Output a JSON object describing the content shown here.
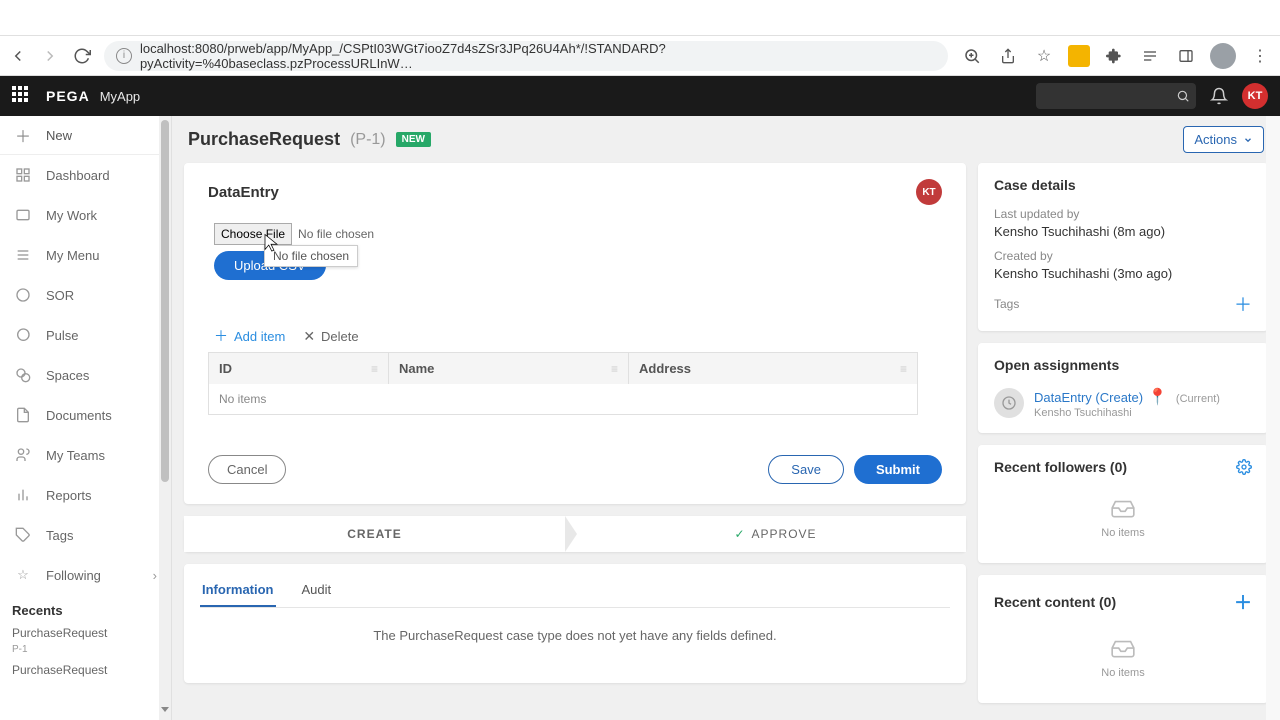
{
  "browser": {
    "url": "localhost:8080/prweb/app/MyApp_/CSPtI03WGt7iooZ7d4sZSr3JPq26U4Ah*/!STANDARD?pyActivity=%40baseclass.pzProcessURLInW…"
  },
  "pegaHeader": {
    "brand": "PEGA",
    "appName": "MyApp",
    "userInitials": "KT"
  },
  "sidebar": {
    "newLabel": "New",
    "items": [
      {
        "label": "Dashboard"
      },
      {
        "label": "My Work"
      },
      {
        "label": "My Menu"
      },
      {
        "label": "SOR"
      },
      {
        "label": "Pulse"
      },
      {
        "label": "Spaces"
      },
      {
        "label": "Documents"
      },
      {
        "label": "My Teams"
      },
      {
        "label": "Reports"
      },
      {
        "label": "Tags"
      },
      {
        "label": "Following"
      }
    ],
    "recentsHeader": "Recents",
    "recents": [
      {
        "label": "PurchaseRequest",
        "sub": "P-1"
      },
      {
        "label": "PurchaseRequest"
      }
    ]
  },
  "caseHeader": {
    "title": "PurchaseRequest",
    "id": "(P-1)",
    "newTag": "NEW",
    "actions": "Actions"
  },
  "dataEntry": {
    "title": "DataEntry",
    "badge": "KT",
    "chooseFile": "Choose File",
    "noFile": "No file chosen",
    "tooltip": "No file chosen",
    "upload": "Upload CSV",
    "addItem": "Add item",
    "delete": "Delete",
    "columns": {
      "id": "ID",
      "name": "Name",
      "address": "Address"
    },
    "noItems": "No items",
    "cancel": "Cancel",
    "save": "Save",
    "submit": "Submit"
  },
  "stages": {
    "create": "CREATE",
    "approve": "APPROVE"
  },
  "tabs": {
    "info": "Information",
    "audit": "Audit",
    "infoBody": "The PurchaseRequest case type does not yet have any fields defined."
  },
  "details": {
    "title": "Case details",
    "lastUpdatedLabel": "Last updated by",
    "lastUpdatedValue": "Kensho Tsuchihashi (8m ago)",
    "createdLabel": "Created by",
    "createdValue": "Kensho Tsuchihashi (3mo ago)",
    "tagsLabel": "Tags"
  },
  "assignments": {
    "title": "Open assignments",
    "name": "DataEntry (Create)",
    "person": "Kensho Tsuchihashi",
    "current": "(Current)"
  },
  "followers": {
    "title": "Recent followers (0)",
    "empty": "No items"
  },
  "recentContent": {
    "title": "Recent content (0)",
    "empty": "No items"
  }
}
